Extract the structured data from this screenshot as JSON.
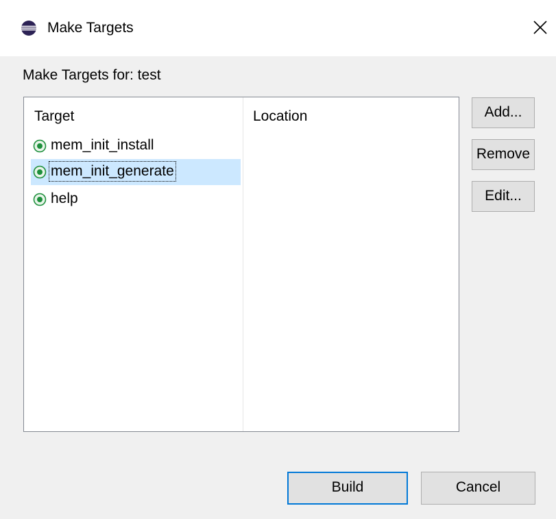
{
  "window": {
    "title": "Make Targets",
    "close_glyph": "✕",
    "icon": "eclipse-icon"
  },
  "header": {
    "label": "Make Targets for: test"
  },
  "table": {
    "columns": [
      "Target",
      "Location"
    ],
    "rows": [
      {
        "target": "mem_init_install",
        "location": "",
        "icon": "make-target-icon",
        "selected": false
      },
      {
        "target": "mem_init_generate",
        "location": "",
        "icon": "make-target-icon",
        "selected": true
      },
      {
        "target": "help",
        "location": "",
        "icon": "make-target-icon",
        "selected": false
      }
    ]
  },
  "side_buttons": {
    "add": "Add...",
    "remove": "Remove",
    "edit": "Edit..."
  },
  "footer": {
    "build": "Build",
    "cancel": "Cancel"
  },
  "colors": {
    "selection": "#cce8ff",
    "default_button_border": "#0078d7",
    "target_icon": "#1e8f3c"
  }
}
